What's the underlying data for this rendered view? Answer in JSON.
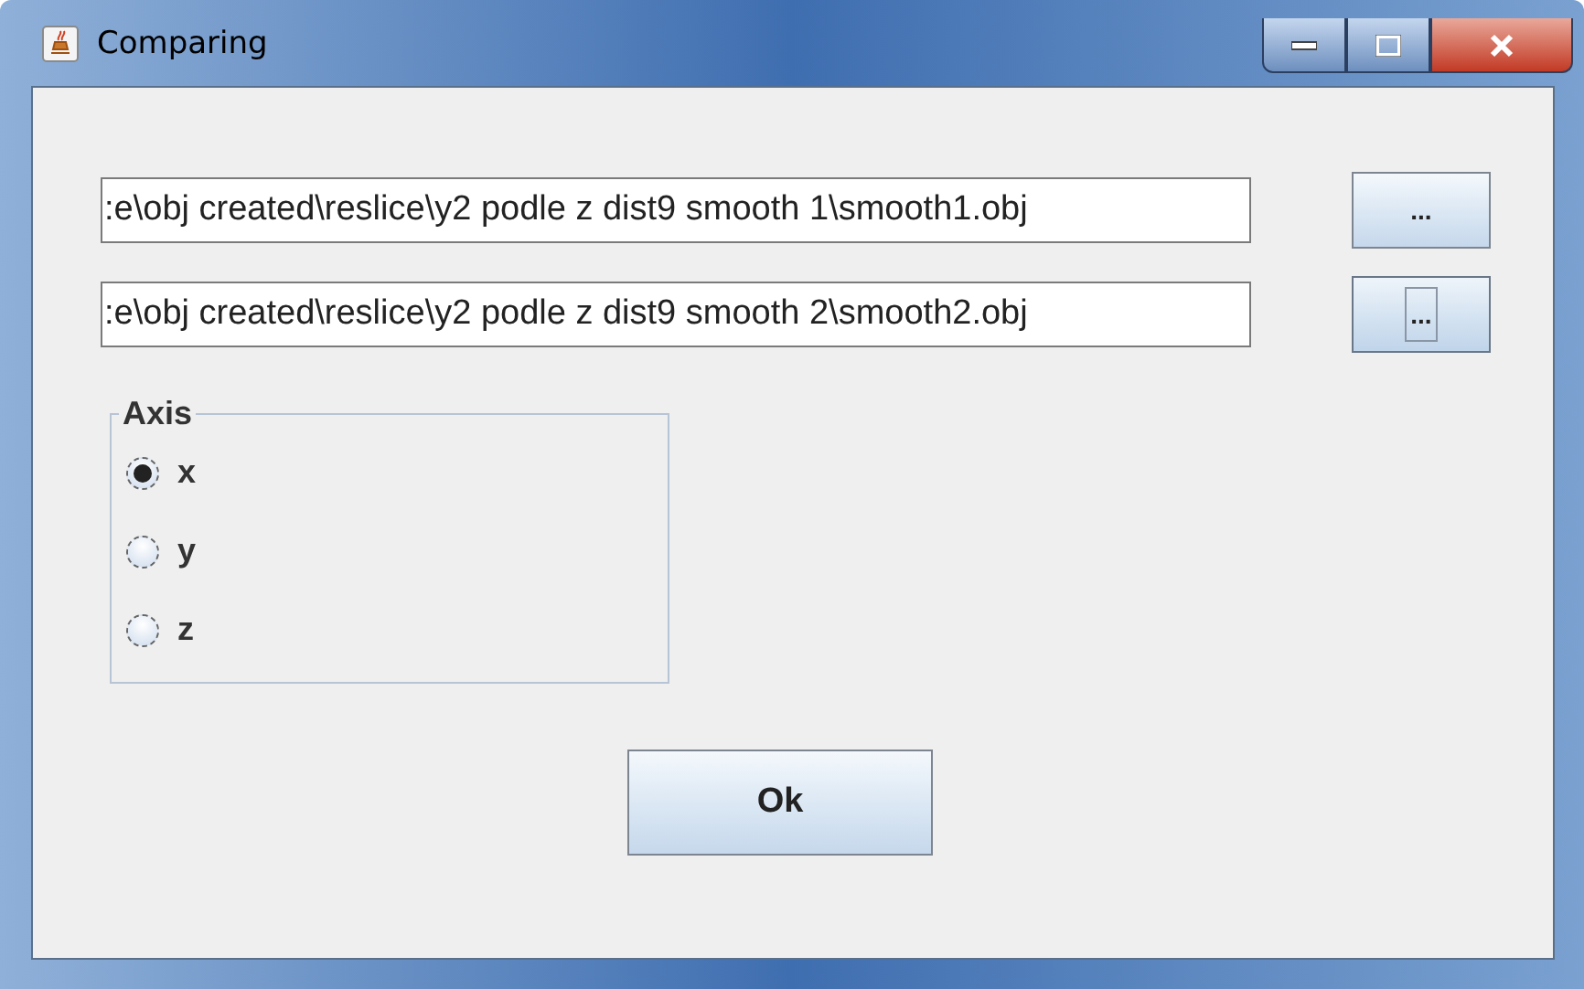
{
  "window": {
    "title": "Comparing"
  },
  "files": [
    {
      "value": ":e\\obj created\\reslice\\y2 podle z dist9 smooth 1\\smooth1.obj",
      "button": "...",
      "focused": false
    },
    {
      "value": ":e\\obj created\\reslice\\y2 podle z dist9 smooth 2\\smooth2.obj",
      "button": "...",
      "focused": true
    }
  ],
  "axis": {
    "title": "Axis",
    "options": [
      {
        "label": "x",
        "selected": true
      },
      {
        "label": "y",
        "selected": false
      },
      {
        "label": "z",
        "selected": false
      }
    ]
  },
  "ok_button": "Ok"
}
